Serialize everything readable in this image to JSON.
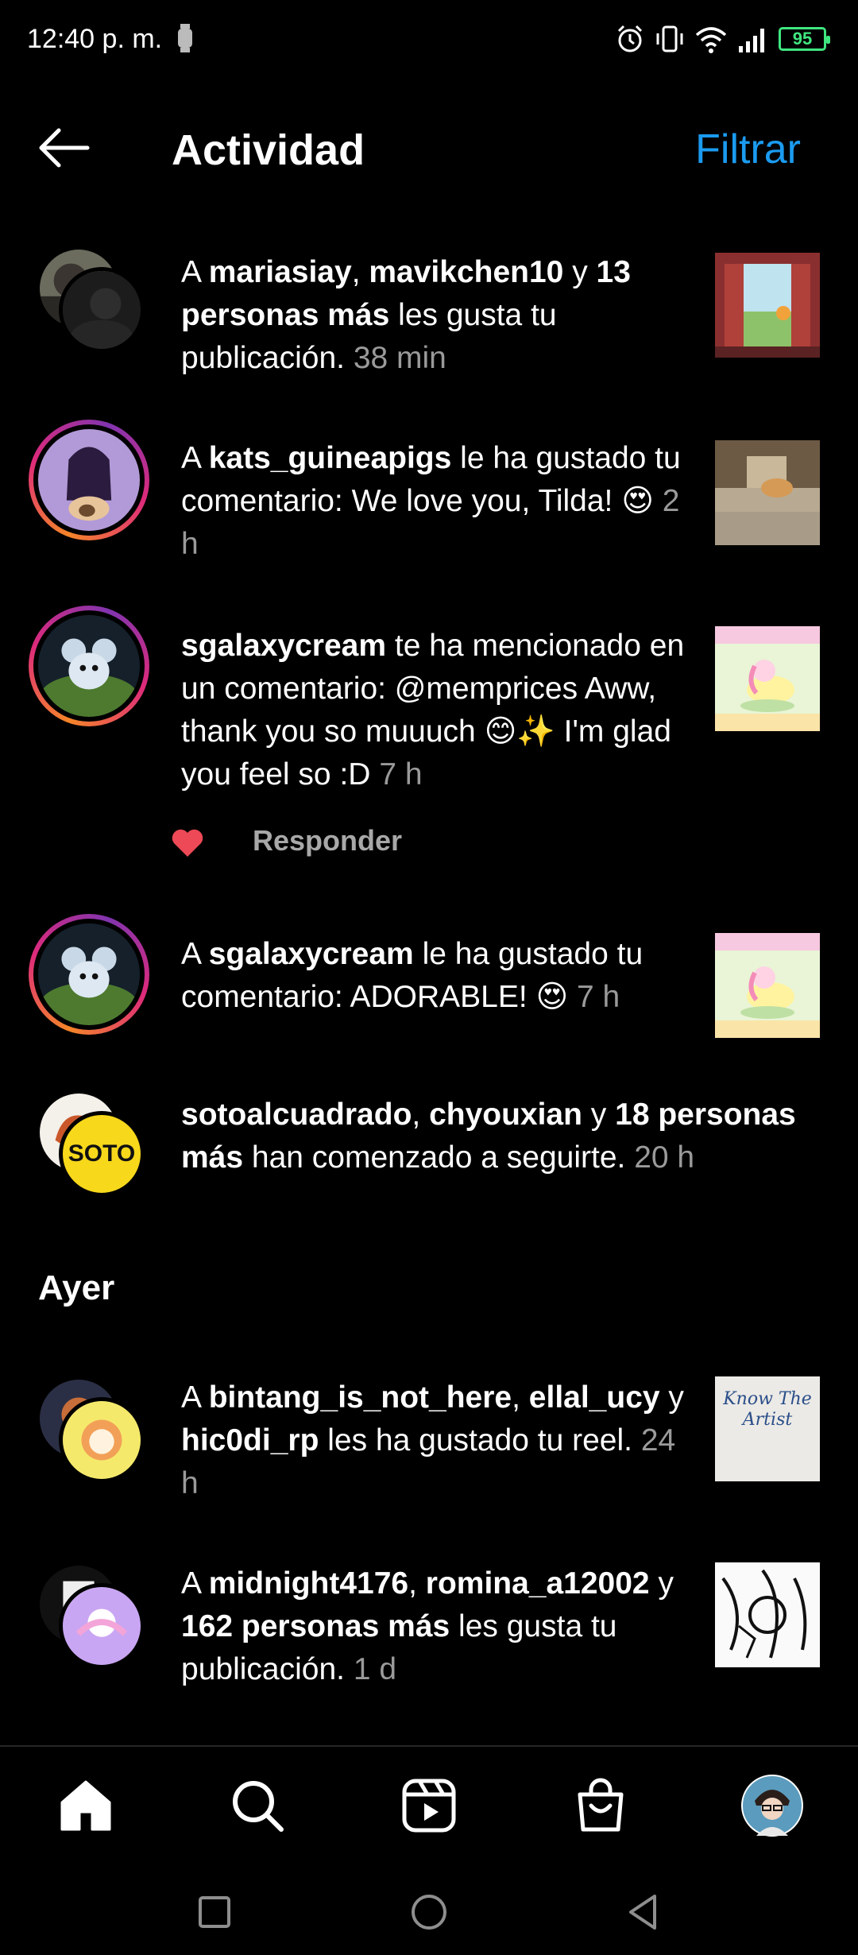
{
  "status_bar": {
    "time": "12:40 p. m.",
    "battery": "95"
  },
  "header": {
    "title": "Actividad",
    "filter_label": "Filtrar"
  },
  "notifications": [
    {
      "parts": [
        "A ",
        "mariasiay",
        ", ",
        "mavikchen10",
        " y ",
        "13 personas más",
        " les gusta tu publicación."
      ],
      "time": "38 min"
    },
    {
      "parts": [
        "A ",
        "kats_guineapigs",
        " le ha gustado tu comentario: We love you, Tilda! 😍"
      ],
      "time": "2 h"
    },
    {
      "parts": [
        "sgalaxycream",
        " te ha mencionado en un comentario: @memprices Aww, thank you so muuuch 😊✨ I'm glad you feel so :D"
      ],
      "time": "7 h",
      "reply_label": "Responder"
    },
    {
      "parts": [
        "A ",
        "sgalaxycream",
        " le ha gustado tu comentario: ADORABLE! 😍"
      ],
      "time": "7 h"
    },
    {
      "parts": [
        "sotoalcuadrado",
        ", ",
        "chyouxian",
        " y ",
        "18 personas más",
        " han comenzado a seguirte."
      ],
      "time": "20 h",
      "avatar_text": "SOTO"
    }
  ],
  "section_yesterday": "Ayer",
  "notifications_yesterday": [
    {
      "parts": [
        "A ",
        "bintang_is_not_here",
        ", ",
        "ellal_ucy",
        " y ",
        "hic0di_rp",
        " les ha gustado tu reel."
      ],
      "time": "24 h",
      "thumb_text": "Know The Artist"
    },
    {
      "parts": [
        "A ",
        "midnight4176",
        ", ",
        "romina_a12002",
        " y ",
        "162 personas más",
        " les gusta tu publicación."
      ],
      "time": "1 d"
    }
  ],
  "colors": {
    "accent": "#1b9bf0",
    "heart": "#ed4956",
    "muted": "#9a9a9a"
  }
}
